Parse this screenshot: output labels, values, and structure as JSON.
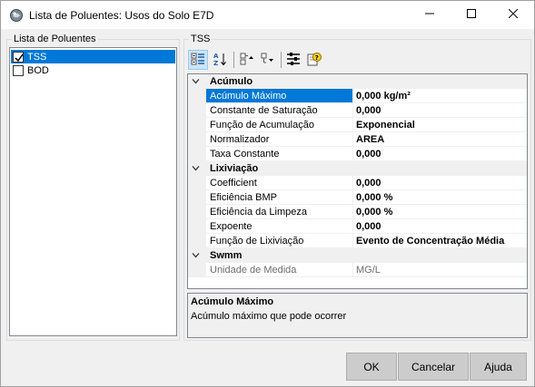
{
  "window": {
    "title": "Lista de Poluentes: Usos do Solo E7D",
    "icons": [
      "app-icon",
      "minimize-icon",
      "maximize-icon",
      "close-icon"
    ]
  },
  "pollutant_list": {
    "label": "Lista de Poluentes",
    "items": [
      {
        "label": "TSS",
        "checked": true,
        "selected": true
      },
      {
        "label": "BOD",
        "checked": false,
        "selected": false
      }
    ]
  },
  "properties": {
    "label": "TSS",
    "toolbar_icons": [
      "categorized-icon",
      "alphabetical-sort-icon",
      "expand-icon",
      "collapse-icon",
      "property-pages-icon",
      "help-icon"
    ],
    "categories": [
      {
        "name": "Acúmulo",
        "rows": [
          {
            "name": "Acúmulo Máximo",
            "value": "0,000 kg/m²",
            "selected": true
          },
          {
            "name": "Constante de Saturação",
            "value": "0,000"
          },
          {
            "name": "Função de Acumulação",
            "value": "Exponencial"
          },
          {
            "name": "Normalizador",
            "value": "AREA"
          },
          {
            "name": "Taxa Constante",
            "value": "0,000"
          }
        ]
      },
      {
        "name": "Lixiviação",
        "rows": [
          {
            "name": "Coefficient",
            "value": "0,000"
          },
          {
            "name": "Eficiência BMP",
            "value": "0,000 %"
          },
          {
            "name": "Eficiência da Limpeza",
            "value": "0,000 %"
          },
          {
            "name": "Expoente",
            "value": "0,000"
          },
          {
            "name": "Função de Lixiviação",
            "value": "Evento de Concentração Média"
          }
        ]
      },
      {
        "name": "Swmm",
        "rows": [
          {
            "name": "Unidade de Medida",
            "value": "MG/L",
            "readonly": true
          }
        ]
      }
    ],
    "help_title": "Acúmulo Máximo",
    "help_desc": "Acúmulo máximo que pode ocorrer"
  },
  "buttons": {
    "ok": "OK",
    "cancel": "Cancelar",
    "help": "Ajuda"
  },
  "colors": {
    "selection": "#0078d7",
    "button_face": "#cccccc",
    "dialog_bg": "#f0f0f0"
  }
}
